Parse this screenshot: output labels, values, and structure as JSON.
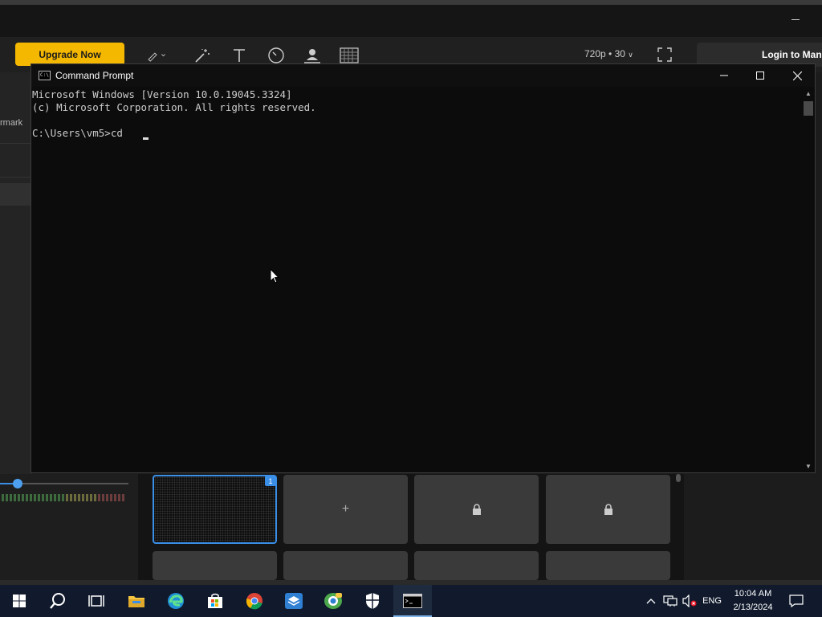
{
  "app": {
    "upgrade_label": "Upgrade Now",
    "resolution_label": "720p • 30",
    "login_label": "Login to Manage",
    "left_label": "rmark",
    "scene_badge": "1",
    "add_scene_symbol": "+",
    "lock_symbol": "🔒",
    "accent_color": "#3a8ee6",
    "brand_color": "#f5b800"
  },
  "cmd": {
    "title": "Command Prompt",
    "icon_text": "C:\\",
    "lines": [
      "Microsoft Windows [Version 10.0.19045.3324]",
      "(c) Microsoft Corporation. All rights reserved.",
      "",
      "C:\\Users\\vm5>cd"
    ]
  },
  "taskbar": {
    "language": "ENG",
    "time": "10:04 AM",
    "date": "2/13/2024",
    "items": [
      "start-icon",
      "search-icon",
      "task-view-icon",
      "file-explorer-icon",
      "edge-icon",
      "store-icon",
      "chrome-icon",
      "mail-icon",
      "recorder-app-icon",
      "security-icon",
      "command-prompt-icon"
    ]
  }
}
